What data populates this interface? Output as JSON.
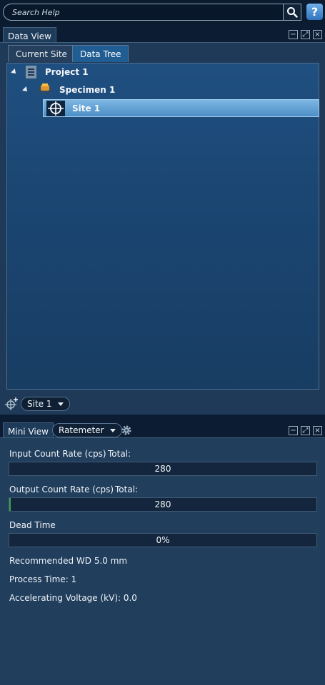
{
  "search": {
    "placeholder": "Search Help"
  },
  "help_label": "?",
  "data_view": {
    "tab_label": "Data View",
    "subtabs": [
      "Current Site",
      "Data Tree"
    ],
    "tree": {
      "project": "Project 1",
      "specimen": "Specimen 1",
      "site": "Site 1"
    },
    "site_selector": "Site 1"
  },
  "mini_view": {
    "tab_label": "Mini View",
    "mode_selector": "Ratemeter",
    "input_rate_label": "Input Count Rate (cps)",
    "input_total_label": "Total:",
    "input_value": "280",
    "output_rate_label": "Output Count Rate (cps)",
    "output_total_label": "Total:",
    "output_value": "280",
    "dead_time_label": "Dead Time",
    "dead_time_value": "0%",
    "recommended_wd": "Recommended WD 5.0 mm",
    "process_time": "Process Time: 1",
    "accelerating_voltage": "Accelerating Voltage (kV): 0.0"
  },
  "icons": [
    "search-icon",
    "help-icon",
    "minimize-icon",
    "maximize-icon",
    "close-icon",
    "project-icon",
    "specimen-icon",
    "site-crosshair-icon",
    "add-site-icon",
    "gear-icon"
  ],
  "colors": {
    "accent": "#2f74bd",
    "selection": "#5c9fd3"
  }
}
